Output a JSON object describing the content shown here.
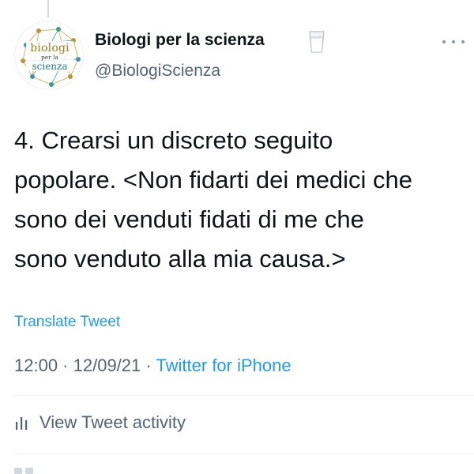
{
  "account": {
    "name": "Biologi per la scienza",
    "handle": "@BiologiScienza",
    "avatar_text": {
      "line1": "biologi",
      "line2": "per la",
      "line3": "scienza"
    },
    "name_emoji_icon": "glass-of-milk-icon"
  },
  "tweet": {
    "text": "4. Crearsi un discreto seguito\npopolare. <Non fidarti dei medici che\nsono dei venduti fidati di me che\nsono venduto alla mia causa.>",
    "translate_label": "Translate Tweet",
    "time": "12:00",
    "separator1": " · ",
    "date": "12/09/21",
    "separator2": " · ",
    "source": "Twitter for iPhone"
  },
  "activity": {
    "label": "View Tweet activity",
    "icon": "bar-chart-icon"
  },
  "icons": {
    "more": "more-options-icon"
  },
  "colors": {
    "link_blue": "#1d9bf0",
    "secondary_gray": "#536471",
    "text_primary": "#0f1419",
    "avatar_gold": "#9a7b16",
    "avatar_teal": "#1f7c7a"
  }
}
